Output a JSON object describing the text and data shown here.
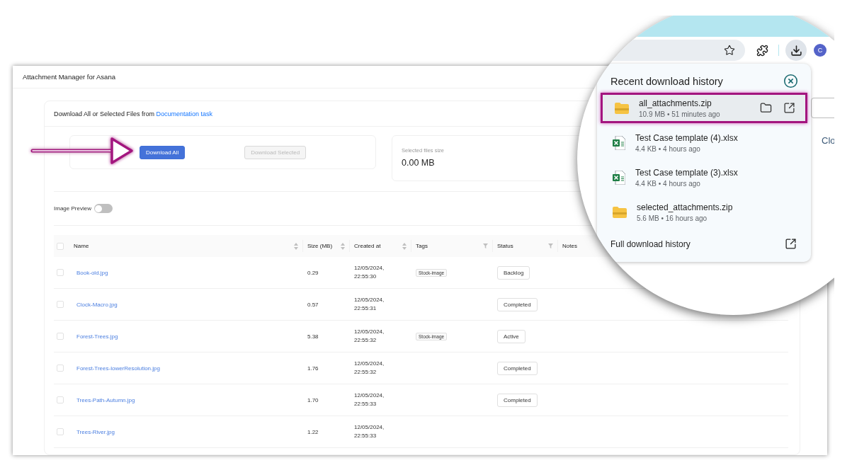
{
  "window": {
    "title": "Attachment Manager for Asana"
  },
  "panel": {
    "heading": "Download All or Selected Files from",
    "task_link": "Documentation task"
  },
  "actions": [
    {
      "label": "Download All",
      "disabled": false
    },
    {
      "label": "Download Selected",
      "disabled": true
    }
  ],
  "selected_size": {
    "label": "Selected files size",
    "value": "0.00 MB"
  },
  "image_preview": {
    "label": "Image Preview",
    "on": false
  },
  "table": {
    "select_all_checked": false,
    "columns": [
      {
        "label": "Name",
        "kind": "sort"
      },
      {
        "label": "Size (MB)",
        "kind": "sort"
      },
      {
        "label": "Created at",
        "kind": "sort"
      },
      {
        "label": "Tags",
        "kind": "filter"
      },
      {
        "label": "Status",
        "kind": "filter"
      },
      {
        "label": "Notes",
        "kind": "plain"
      }
    ],
    "rows": [
      {
        "checked": false,
        "name": "Book-old.jpg",
        "size": "0.29",
        "created": "12/05/2024, 22:55:30",
        "tags": [
          "Stock-image"
        ],
        "status": "Backlog"
      },
      {
        "checked": false,
        "name": "Clock-Macro.jpg",
        "size": "0.57",
        "created": "12/05/2024, 22:55:31",
        "status": "Completed"
      },
      {
        "checked": false,
        "name": "Forest-Trees.jpg",
        "size": "5.38",
        "created": "12/05/2024, 22:55:32",
        "tags": [
          "Stock-image"
        ],
        "status": "Active"
      },
      {
        "checked": false,
        "name": "Forest-Trees-lowerResolution.jpg",
        "size": "1.76",
        "created": "12/05/2024, 22:55:32",
        "status": "Completed"
      },
      {
        "checked": false,
        "name": "Trees-Path-Autumn.jpg",
        "size": "1.70",
        "created": "12/05/2024, 22:55:33",
        "status": "Completed"
      },
      {
        "checked": false,
        "name": "Trees-River.jpg",
        "size": "1.22",
        "created": "12/05/2024, 22:55:33"
      }
    ]
  },
  "browser": {
    "avatar": "C",
    "page_fragment": "Clo",
    "downloads": {
      "title": "Recent download history",
      "items": [
        {
          "name": "all_attachments.zip",
          "meta": "10.9 MB • 51 minutes ago",
          "kind": "zip",
          "highlighted": true
        },
        {
          "name": "Test Case template (4).xlsx",
          "meta": "4.4 KB • 4 hours ago",
          "kind": "xlsx",
          "highlighted": false
        },
        {
          "name": "Test Case template (3).xlsx",
          "meta": "4.4 KB • 4 hours ago",
          "kind": "xlsx",
          "highlighted": false
        },
        {
          "name": "selected_attachments.zip",
          "meta": "5.6 MB • 16 hours ago",
          "kind": "zip",
          "highlighted": false
        }
      ],
      "footer": "Full download history"
    }
  }
}
